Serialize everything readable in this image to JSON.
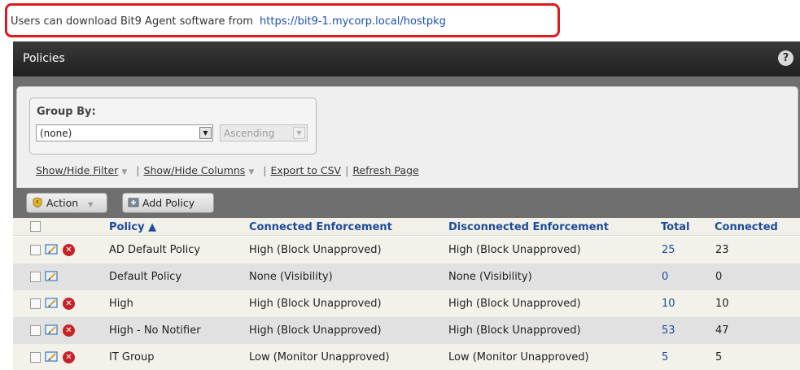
{
  "banner": {
    "text": "Users can download Bit9 Agent software from",
    "url": "https://bit9-1.mycorp.local/hostpkg"
  },
  "panel": {
    "title": "Policies",
    "help": "?"
  },
  "group_by": {
    "label": "Group By:",
    "value": "(none)",
    "sort_value": "Ascending"
  },
  "links": {
    "filter": "Show/Hide Filter",
    "columns": "Show/Hide Columns",
    "export": "Export to CSV",
    "refresh": "Refresh Page"
  },
  "toolbar": {
    "action": "Action",
    "add_policy": "Add Policy"
  },
  "table": {
    "headers": {
      "policy": "Policy ▲",
      "connected": "Connected Enforcement",
      "disconnected": "Disconnected Enforcement",
      "total": "Total",
      "connected_count": "Connected"
    },
    "rows": [
      {
        "policy": "AD Default Policy",
        "conn": "High (Block Unapproved)",
        "disc": "High (Block Unapproved)",
        "total": "25",
        "connected": "23",
        "deletable": true
      },
      {
        "policy": "Default Policy",
        "conn": "None (Visibility)",
        "disc": "None (Visibility)",
        "total": "0",
        "connected": "0",
        "deletable": false
      },
      {
        "policy": "High",
        "conn": "High (Block Unapproved)",
        "disc": "High (Block Unapproved)",
        "total": "10",
        "connected": "10",
        "deletable": true
      },
      {
        "policy": "High - No Notifier",
        "conn": "High (Block Unapproved)",
        "disc": "High (Block Unapproved)",
        "total": "53",
        "connected": "47",
        "deletable": true
      },
      {
        "policy": "IT Group",
        "conn": "Low (Monitor Unapproved)",
        "disc": "Low (Monitor Unapproved)",
        "total": "5",
        "connected": "5",
        "deletable": true
      }
    ]
  },
  "colors": {
    "banner_border": "#e0191e",
    "link": "#1c4b9a",
    "header_bar": "#2a2a2a",
    "delete_icon": "#c5232a"
  },
  "icons": [
    "help-icon",
    "dropdown-arrow-icon",
    "shield-icon",
    "add-icon",
    "edit-icon",
    "delete-icon",
    "sort-ascending-icon"
  ]
}
